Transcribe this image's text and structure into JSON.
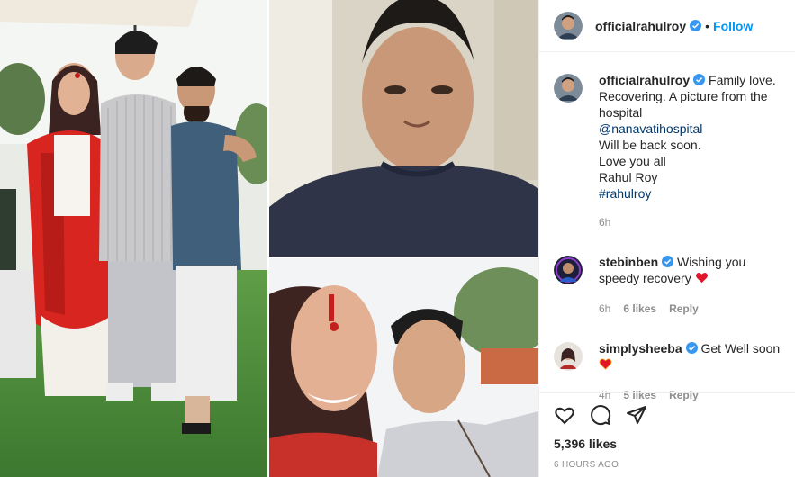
{
  "post": {
    "username": "officialrahulroy",
    "follow_label": "Follow",
    "dot": "•"
  },
  "caption": {
    "username": "officialrahulroy",
    "lines": [
      "Family love.",
      "Recovering. A picture from the",
      "hospital",
      "@nanavatihospital",
      "Will be back soon.",
      "Love you all",
      "Rahul Roy",
      "#rahulroy"
    ],
    "time": "6h"
  },
  "comments": [
    {
      "username": "stebinben",
      "text": "Wishing you speedy recovery",
      "time": "6h",
      "likes": "6 likes",
      "reply": "Reply"
    },
    {
      "username": "simplysheeba",
      "text": "Get Well soon",
      "time": "4h",
      "likes": "5 likes",
      "reply": "Reply"
    }
  ],
  "footer": {
    "likes": "5,396 likes",
    "ago": "6 HOURS AGO"
  },
  "icons": {
    "verified": "verified-badge-icon",
    "like": "heart-outline-icon",
    "comment": "speech-bubble-icon",
    "share": "paper-plane-icon",
    "heart_emoji": "red-heart-icon"
  },
  "colors": {
    "link": "#00376b",
    "follow": "#0095f6",
    "verified": "#3897f0",
    "muted": "#8e8e8e"
  }
}
